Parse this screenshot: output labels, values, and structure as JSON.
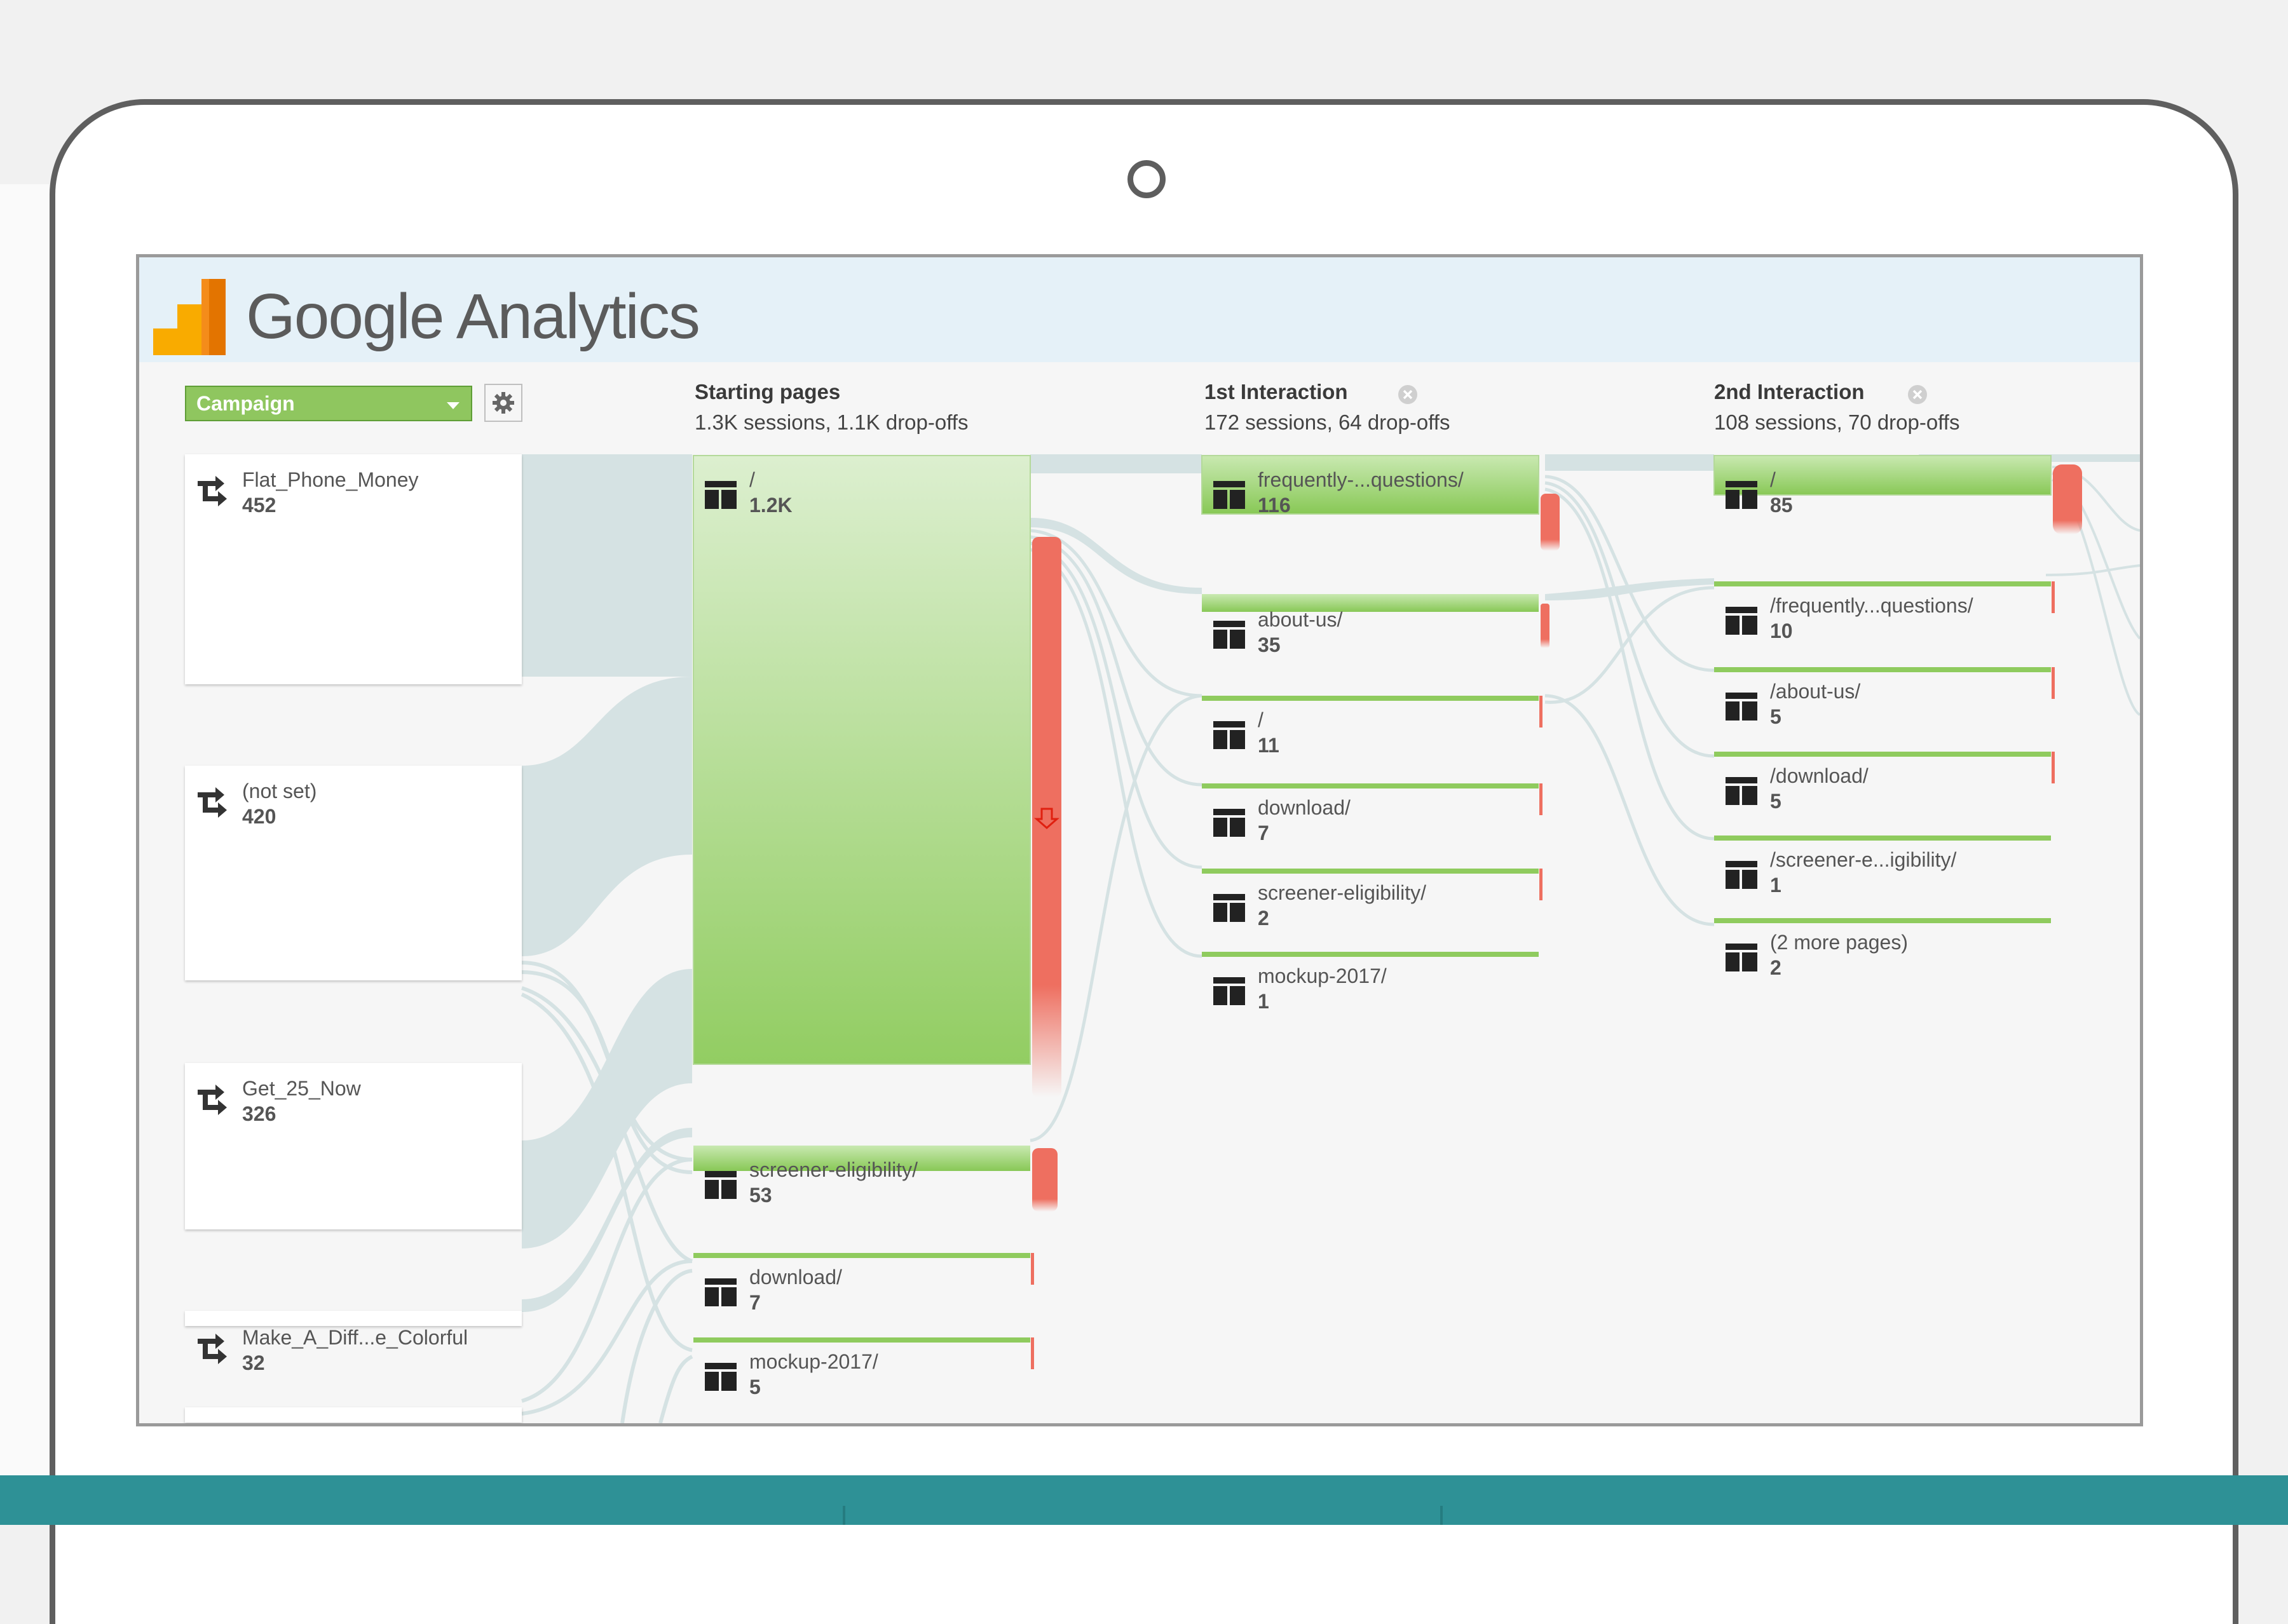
{
  "app": {
    "logo_title": "Google Analytics"
  },
  "controls": {
    "dimension_label": "Campaign"
  },
  "columns": {
    "starting": {
      "title": "Starting pages",
      "stats": "1.3K sessions, 1.1K drop-offs"
    },
    "first": {
      "title": "1st Interaction",
      "stats": "172 sessions, 64 drop-offs"
    },
    "second": {
      "title": "2nd Interaction",
      "stats": "108 sessions, 70 drop-offs"
    }
  },
  "sources": [
    {
      "name": "Flat_Phone_Money",
      "count": "452"
    },
    {
      "name": "(not set)",
      "count": "420"
    },
    {
      "name": "Get_25_Now",
      "count": "326"
    },
    {
      "name": "Make_A_Diff...e_Colorful",
      "count": "32"
    }
  ],
  "starting_pages": [
    {
      "name": "/",
      "count": "1.2K"
    },
    {
      "name": "screener-eligibility/",
      "count": "53"
    },
    {
      "name": "download/",
      "count": "7"
    },
    {
      "name": "mockup-2017/",
      "count": "5"
    }
  ],
  "first_interaction": [
    {
      "name": "frequently-...questions/",
      "count": "116"
    },
    {
      "name": "about-us/",
      "count": "35"
    },
    {
      "name": "/",
      "count": "11"
    },
    {
      "name": "download/",
      "count": "7"
    },
    {
      "name": "screener-eligibility/",
      "count": "2"
    },
    {
      "name": "mockup-2017/",
      "count": "1"
    }
  ],
  "second_interaction": [
    {
      "name": "/",
      "count": "85"
    },
    {
      "name": "/frequently...questions/",
      "count": "10"
    },
    {
      "name": "/about-us/",
      "count": "5"
    },
    {
      "name": "/download/",
      "count": "5"
    },
    {
      "name": "/screener-e...igibility/",
      "count": "1"
    },
    {
      "name": "(2 more pages)",
      "count": "2"
    }
  ],
  "colors": {
    "node_green": "#8fcb5e",
    "dropoff_red": "#ee6f60",
    "flow_gray": "#d4e1e2",
    "accent_teal": "#2e9196"
  }
}
